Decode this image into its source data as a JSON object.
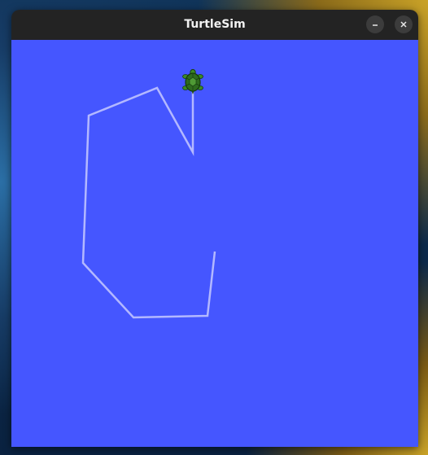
{
  "window": {
    "title": "TurtleSim",
    "minimize_icon": "minimize-icon",
    "close_icon": "close-icon"
  },
  "canvas": {
    "background_color": "#4556ff",
    "pen_color": "#b3b8ff",
    "turtle_icon": "turtle-icon",
    "turtle_color": "#2e6b1e"
  },
  "desktop": {
    "accent_color": "#c9a227"
  }
}
